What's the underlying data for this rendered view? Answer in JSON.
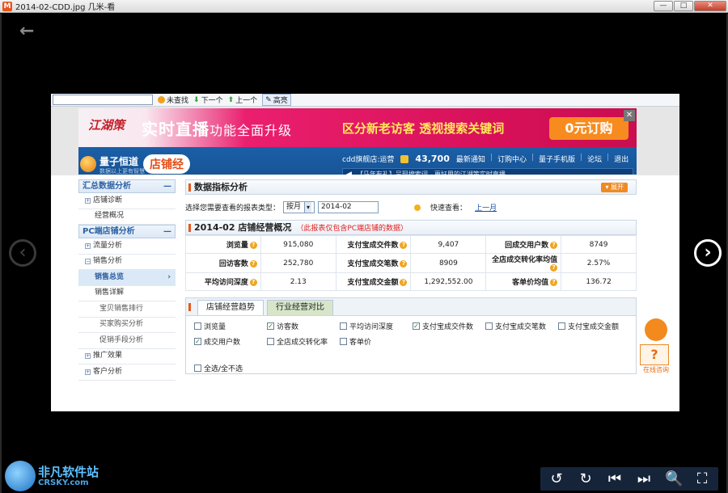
{
  "window": {
    "title": "2014-02-CDD.jpg  几米-看",
    "app_icon": "M",
    "controls": {
      "minimize": "—",
      "maximize": "□",
      "close": "✕"
    }
  },
  "viewer": {
    "back_icon": "←",
    "prev_icon": "‹",
    "next_icon": "›",
    "tools": [
      "↺",
      "↻",
      "⏮",
      "⏭",
      "🔍",
      "⛶"
    ],
    "watermark": {
      "name": "非凡软件站",
      "domain": "CRSKY.com"
    }
  },
  "browser_bar": {
    "find_placeholder": "",
    "buttons": [
      "未查找",
      "下一个",
      "上一个",
      "高亮"
    ]
  },
  "ad": {
    "logo": "江湖策",
    "headline_big": "实时直播",
    "headline_small": "功能全面升级",
    "subline": "区分新老访客  透视搜索关键词",
    "cta": "0元订购",
    "close": "✕"
  },
  "header": {
    "brand": "量子恒道",
    "slogan": "数据以上更有智慧",
    "product": "店铺经",
    "shop_name": "cdd旗舰店:运营",
    "coins": "43,700",
    "links": [
      "最新通知",
      "订购中心",
      "量子手机版",
      "论坛",
      "退出"
    ],
    "notice": "【马年有礼】呈现搜索词，更好用的江湖策实时直播"
  },
  "sidebar": {
    "groups": [
      {
        "label": "汇总数据分析",
        "items": [
          "店铺诊断",
          "经营概况"
        ]
      },
      {
        "label": "PC端店铺分析",
        "items": [
          "流量分析",
          "销售分析"
        ]
      }
    ],
    "sales_children": [
      "销售总览",
      "销售详解"
    ],
    "detail_children": [
      "宝贝销售排行",
      "买家购买分析",
      "促销手段分析"
    ],
    "more": [
      "推广效果",
      "客户分析"
    ]
  },
  "main": {
    "section_title": "数据指标分析",
    "expand": "展开",
    "selector_label": "选择您需要查看的报表类型：",
    "period": "按月",
    "date": "2014-02",
    "quick_label": "快速查看：",
    "quick_link": "上一月",
    "overview_title": "2014-02 店铺经营概况",
    "overview_note": "（此报表仅包含PC端店铺的数据）",
    "kpis": [
      [
        "浏览量",
        "915,080",
        "支付宝成交件数",
        "9,407",
        "回成交用户数",
        "8749"
      ],
      [
        "回访客数",
        "252,780",
        "支付宝成交笔数",
        "8909",
        "全店成交转化率均值",
        "2.57%"
      ],
      [
        "平均访问深度",
        "2.13",
        "支付宝成交金额",
        "1,292,552.00",
        "客单价均值",
        "136.72"
      ]
    ],
    "tabs": [
      "店铺经营趋势",
      "行业经营对比"
    ],
    "checks": [
      {
        "label": "浏览量",
        "checked": false
      },
      {
        "label": "访客数",
        "checked": true
      },
      {
        "label": "平均访问深度",
        "checked": false
      },
      {
        "label": "支付宝成交件数",
        "checked": true
      },
      {
        "label": "支付宝成交笔数",
        "checked": false
      },
      {
        "label": "支付宝成交金额",
        "checked": false
      },
      {
        "label": "成交用户数",
        "checked": true
      },
      {
        "label": "全店成交转化率",
        "checked": false
      },
      {
        "label": "客单价",
        "checked": false
      }
    ],
    "select_all": "全选/全不选"
  },
  "mascot": {
    "label": "在线咨询",
    "icon": "?"
  }
}
